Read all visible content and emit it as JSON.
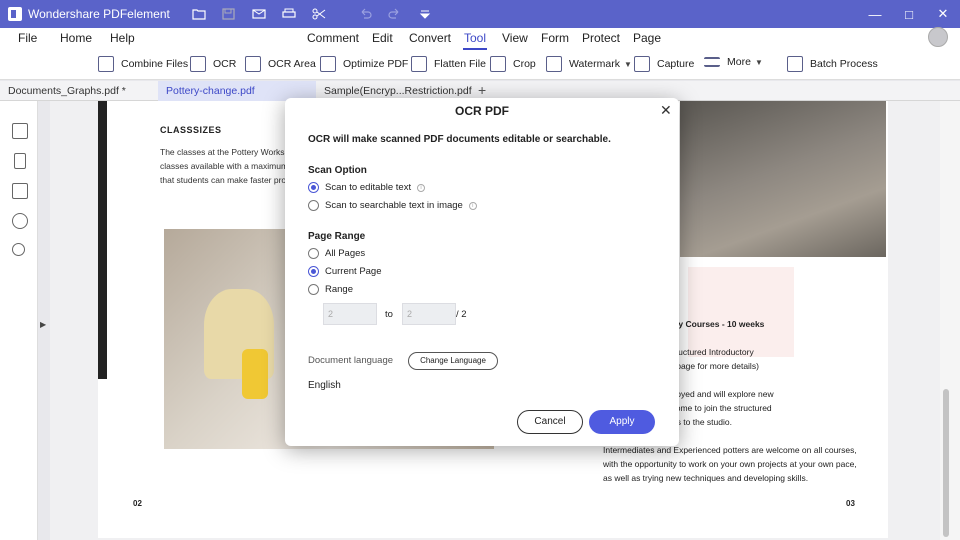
{
  "window": {
    "title": "Wondershare PDFelement",
    "accent": "#5a63c9"
  },
  "menu": [
    "File",
    "Home",
    "Help",
    "Comment",
    "Edit",
    "Convert",
    "Tool",
    "View",
    "Form",
    "Protect",
    "Page"
  ],
  "menu_active": "Tool",
  "toolbar": {
    "combine": "Combine Files",
    "ocr": "OCR",
    "ocr_area": "OCR Area",
    "optimize": "Optimize PDF",
    "flatten": "Flatten File",
    "crop": "Crop",
    "watermark": "Watermark",
    "capture": "Capture",
    "more": "More",
    "batch": "Batch Process"
  },
  "tabs": [
    {
      "label": "Documents_Graphs.pdf *"
    },
    {
      "label": "Pottery-change.pdf"
    },
    {
      "label": "Sample(Encryp...Restriction.pdf"
    }
  ],
  "page": {
    "heading": "CLASSSIZES",
    "lines": [
      "The classes at the Pottery Works Stu",
      "classes available with a maximum 4",
      "that students can make faster prog"
    ],
    "right_lines": [
      "utumn Term Pottery Courses - 10 weeks",
      "ll the basics on a structured Introductory",
      "ory Pottery Course page for more details)",
      "techniques they enjoyed and will explore new",
      "overs are also welcome to join the structured",
      "with the new-comers to the studio.",
      "Intermediates and Experienced potters are welcome on all courses,",
      "with the opportunity to work on your own projects at your own pace,",
      "as well as trying new techniques and developing skills."
    ],
    "page_left": "02",
    "page_right": "03"
  },
  "dialog": {
    "title": "OCR PDF",
    "intro": "OCR will make scanned PDF documents editable or searchable.",
    "scan_option_label": "Scan Option",
    "scan_options": [
      "Scan to editable text",
      "Scan to searchable text in image"
    ],
    "scan_selected": 0,
    "page_range_label": "Page Range",
    "range_options": [
      "All Pages",
      "Current Page",
      "Range"
    ],
    "range_selected": 1,
    "range_from": "2",
    "range_to": "2",
    "range_to_label": "to",
    "range_total": "/ 2",
    "doc_language_label": "Document language",
    "change_language": "Change Language",
    "language": "English",
    "cancel": "Cancel",
    "apply": "Apply",
    "apply_color": "#4f5be0"
  }
}
